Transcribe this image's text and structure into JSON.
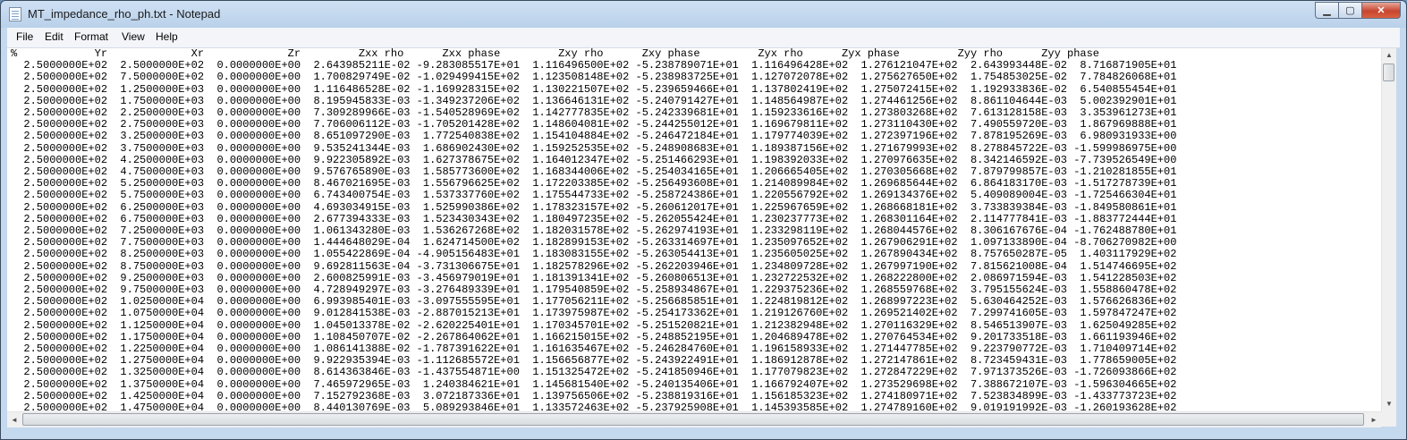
{
  "window": {
    "title": "MT_impedance_rho_ph.txt - Notepad"
  },
  "caption": {
    "minimize": "▁",
    "maximize": "▢",
    "close": "✕"
  },
  "menu": [
    "File",
    "Edit",
    "Format",
    "View",
    "Help"
  ],
  "icons": {
    "app": "notepad-icon",
    "scroll_up": "▲",
    "scroll_down": "▼",
    "scroll_left": "◄",
    "scroll_right": "►"
  },
  "document": {
    "header": "%            Yr             Xr             Zr         Zxx rho      Zxx phase         Zxy rho      Zxy phase         Zyx rho      Zyx phase         Zyy rho      Zyy phase",
    "rows": [
      "  2.5000000E+02  2.5000000E+02  0.0000000E+00  2.643985211E-02 -9.283085517E+01  1.116496500E+02 -5.238789071E+01  1.116496428E+02  1.276121047E+02  2.643993448E-02  8.716871905E+01",
      "  2.5000000E+02  7.5000000E+02  0.0000000E+00  1.700829749E-02 -1.029499415E+02  1.123508148E+02 -5.238983725E+01  1.127072078E+02  1.275627650E+02  1.754853025E-02  7.784826068E+01",
      "  2.5000000E+02  1.2500000E+03  0.0000000E+00  1.116486528E-02 -1.169928315E+02  1.130221507E+02 -5.239659466E+01  1.137802419E+02  1.275072415E+02  1.192933836E-02  6.540855454E+01",
      "  2.5000000E+02  1.7500000E+03  0.0000000E+00  8.195945833E-03 -1.349237206E+02  1.136646131E+02 -5.240791427E+01  1.148564987E+02  1.274461256E+02  8.861104644E-03  5.002392901E+01",
      "  2.5000000E+02  2.2500000E+03  0.0000000E+00  7.309289966E-03 -1.540528969E+02  1.142777835E+02 -5.242339681E+01  1.159233616E+02  1.273803268E+02  7.613128158E-03  3.353961273E+01",
      "  2.5000000E+02  2.7500000E+03  0.0000000E+00  7.706006112E-03 -1.705201428E+02  1.148604081E+02 -5.244255012E+01  1.169679811E+02  1.273110430E+02  7.490559720E-03  1.867969888E+01",
      "  2.5000000E+02  3.2500000E+03  0.0000000E+00  8.651097290E-03  1.772540838E+02  1.154104884E+02 -5.246472184E+01  1.179774039E+02  1.272397196E+02  7.878195269E-03  6.980931933E+00",
      "  2.5000000E+02  3.7500000E+03  0.0000000E+00  9.535241344E-03  1.686902430E+02  1.159252535E+02 -5.248908683E+01  1.189387156E+02  1.271679993E+02  8.278845722E-03 -1.599986975E+00",
      "  2.5000000E+02  4.2500000E+03  0.0000000E+00  9.922305892E-03  1.627378675E+02  1.164012347E+02 -5.251466293E+01  1.198392033E+02  1.270976635E+02  8.342146592E-03 -7.739526549E+00",
      "  2.5000000E+02  4.7500000E+03  0.0000000E+00  9.576765890E-03  1.585773600E+02  1.168344006E+02 -5.254034165E+01  1.206665405E+02  1.270305668E+02  7.879799857E-03 -1.210281855E+01",
      "  2.5000000E+02  5.2500000E+03  0.0000000E+00  8.467021695E-03  1.556796625E+02  1.172203385E+02 -5.256493608E+01  1.214089984E+02  1.269685644E+02  6.864183170E-03 -1.517278739E+01",
      "  2.5000000E+02  5.7500000E+03  0.0000000E+00  6.743400754E-03  1.537337760E+02  1.175544733E+02 -5.258724386E+01  1.220556792E+02  1.269134376E+02  5.409089004E-03 -1.725466304E+01",
      "  2.5000000E+02  6.2500000E+03  0.0000000E+00  4.693034915E-03  1.525990386E+02  1.178323157E+02 -5.260612017E+01  1.225967659E+02  1.268668181E+02  3.733839384E-03 -1.849580861E+01",
      "  2.5000000E+02  6.7500000E+03  0.0000000E+00  2.677394333E-03  1.523430343E+02  1.180497235E+02 -5.262055424E+01  1.230237773E+02  1.268301164E+02  2.114777841E-03 -1.883772444E+01",
      "  2.5000000E+02  7.2500000E+03  0.0000000E+00  1.061343280E-03  1.536267268E+02  1.182031578E+02 -5.262974193E+01  1.233298119E+02  1.268044576E+02  8.306167676E-04 -1.762488780E+01",
      "  2.5000000E+02  7.7500000E+03  0.0000000E+00  1.444648029E-04  1.624714500E+02  1.182899153E+02 -5.263314697E+01  1.235097652E+02  1.267906291E+02  1.097133890E-04 -8.706270982E+00",
      "  2.5000000E+02  8.2500000E+03  0.0000000E+00  1.055422869E-04 -4.905156483E+01  1.183083155E+02 -5.263054413E+01  1.235605025E+02  1.267890434E+02  8.757650287E-05  1.403117929E+02",
      "  2.5000000E+02  8.7500000E+03  0.0000000E+00  9.692811563E-04 -3.731306675E+01  1.182578296E+02 -5.262203946E+01  1.234809728E+02  1.267997190E+02  7.815621008E-04  1.514746695E+02",
      "  2.5000000E+02  9.2500000E+03  0.0000000E+00  2.600825991E-03 -3.456979019E+01  1.181391341E+02 -5.260806513E+01  1.232722532E+02  1.268222800E+02  2.086971594E-03  1.541228503E+02",
      "  2.5000000E+02  9.7500000E+03  0.0000000E+00  4.728949297E-03 -3.276489339E+01  1.179540859E+02 -5.258934867E+01  1.229375236E+02  1.268559768E+02  3.795155624E-03  1.558860478E+02",
      "  2.5000000E+02  1.0250000E+04  0.0000000E+00  6.993985401E-03 -3.097555595E+01  1.177056211E+02 -5.256685851E+01  1.224819812E+02  1.268997223E+02  5.630464252E-03  1.576626836E+02",
      "  2.5000000E+02  1.0750000E+04  0.0000000E+00  9.012841538E-03 -2.887015213E+01  1.173975987E+02 -5.254173362E+01  1.219126760E+02  1.269521402E+02  7.299741605E-03  1.597847247E+02",
      "  2.5000000E+02  1.1250000E+04  0.0000000E+00  1.045013378E-02 -2.620225401E+01  1.170345701E+02 -5.251520821E+01  1.212382948E+02  1.270116329E+02  8.546513907E-03  1.625049285E+02",
      "  2.5000000E+02  1.1750000E+04  0.0000000E+00  1.108450707E-02 -2.267864062E+01  1.166215015E+02 -5.248852195E+01  1.204689478E+02  1.270764534E+02  9.201733518E-03  1.661193946E+02",
      "  2.5000000E+02  1.2250000E+04  0.0000000E+00  1.086141388E-02 -1.787391622E+01  1.161635467E+02 -5.246284760E+01  1.196158933E+02  1.271447785E+02  9.223790772E-03  1.710409714E+02",
      "  2.5000000E+02  1.2750000E+04  0.0000000E+00  9.922935394E-03 -1.112685572E+01  1.156656877E+02 -5.243922491E+01  1.186912878E+02  1.272147861E+02  8.723459431E-03  1.778659005E+02",
      "  2.5000000E+02  1.3250000E+04  0.0000000E+00  8.614363846E-03 -1.437554871E+00  1.151325472E+02 -5.241850946E+01  1.177079823E+02  1.272847229E+02  7.971373526E-03 -1.726093866E+02",
      "  2.5000000E+02  1.3750000E+04  0.0000000E+00  7.465972965E-03  1.240384621E+01  1.145681540E+02 -5.240135406E+01  1.166792407E+02  1.273529698E+02  7.388672107E-03 -1.596304665E+02",
      "  2.5000000E+02  1.4250000E+04  0.0000000E+00  7.152792368E-03  3.072187336E+01  1.139756506E+02 -5.238819316E+01  1.156185323E+02  1.274180971E+02  7.523834899E-03 -1.433773723E+02",
      "  2.5000000E+02  1.4750000E+04  0.0000000E+00  8.440130769E-03  5.089293846E+01  1.133572463E+02 -5.237925908E+01  1.145393585E+02  1.274789160E+02  9.019191992E-03 -1.260193628E+02"
    ]
  }
}
